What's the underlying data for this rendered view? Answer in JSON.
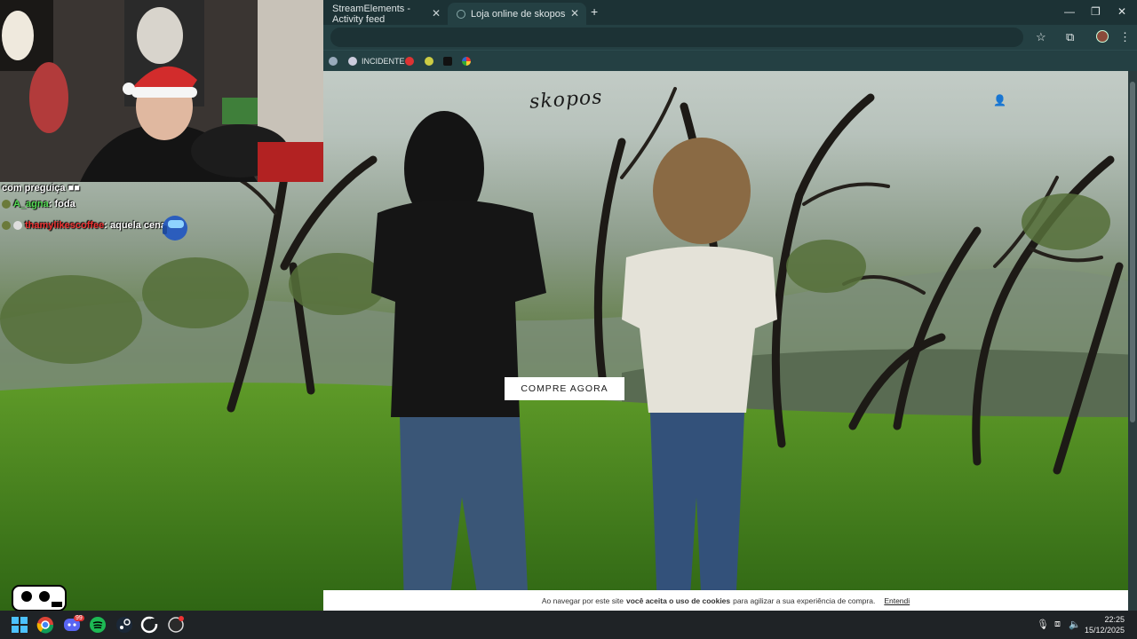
{
  "browser": {
    "tabs": [
      {
        "label": "StreamElements - Activity feed"
      },
      {
        "label": "Loja online de skopos"
      }
    ],
    "new_tab_symbol": "+",
    "bookmarks": [
      {
        "label": "INCIDENTE"
      }
    ]
  },
  "page": {
    "logo_text": "skopos",
    "cta_label": "COMPRE AGORA",
    "cookie_prefix": "Ao navegar por este site",
    "cookie_bold": "você aceita o uso de cookies",
    "cookie_suffix": "para agilizar a sua experiência de compra.",
    "cookie_accept": "Entendi"
  },
  "chat": {
    "lines": [
      {
        "user": "",
        "text": "com preguiça ■■"
      },
      {
        "user": "A_agna",
        "text": "foda"
      },
      {
        "user": "thamylikescoffee",
        "text": "aquela cena"
      }
    ]
  },
  "taskbar": {
    "time": "22:25",
    "date": "15/12/2025",
    "discord_badge": "99"
  },
  "colors": {
    "chrome_dark": "#1c3235",
    "chrome_mid": "#244043",
    "accent_red": "#e33333",
    "grass": "#4f8a22"
  },
  "icons": [
    "close-icon",
    "minimize-icon",
    "maximize-icon",
    "star-icon",
    "extensions-icon",
    "menu-icon",
    "user-icon",
    "windows-start-icon",
    "chrome-icon",
    "discord-icon",
    "spotify-icon",
    "steam-icon",
    "mic-icon",
    "speaker-icon"
  ]
}
